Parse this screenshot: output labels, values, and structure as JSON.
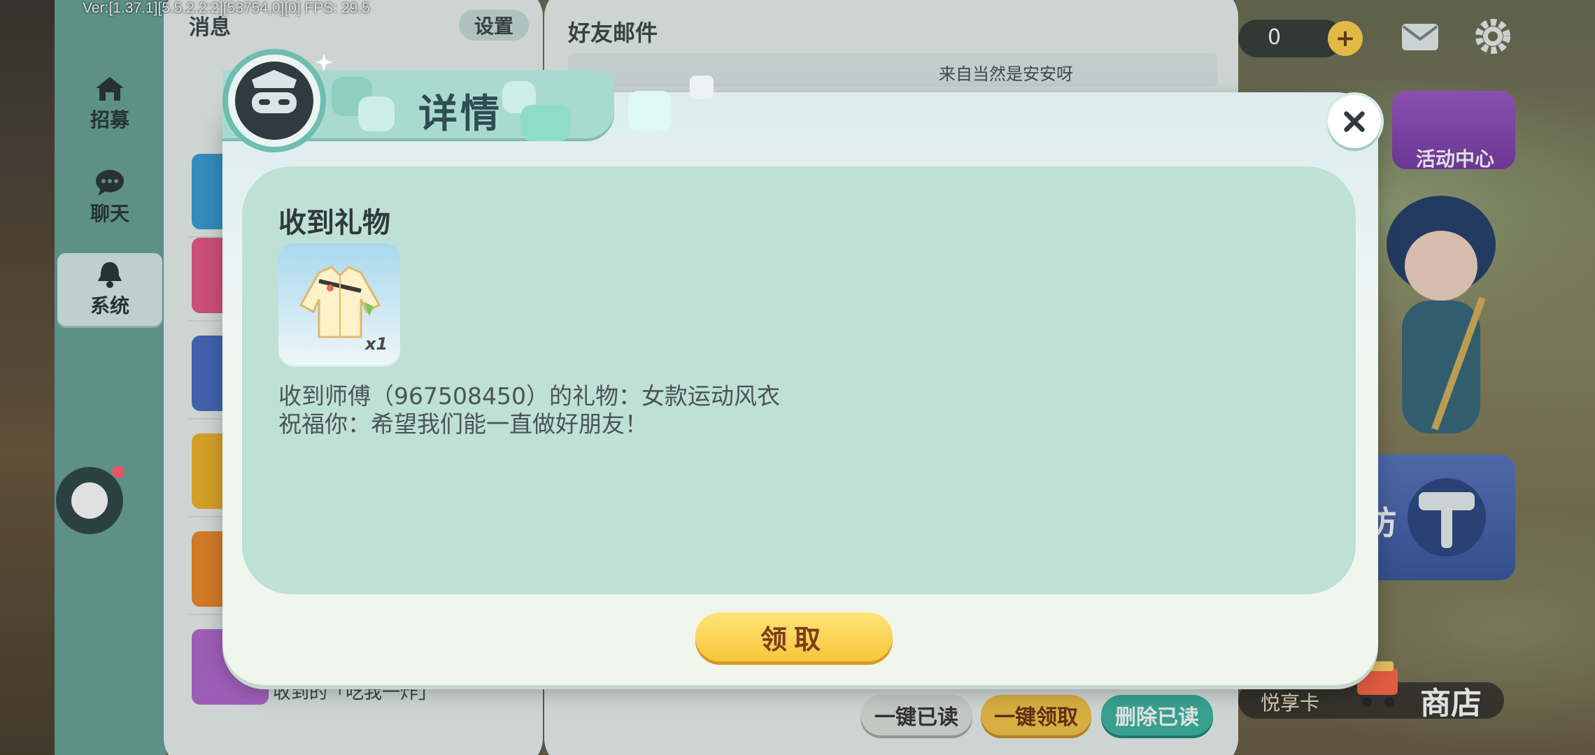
{
  "debug": {
    "text": "Ver:[1.37.1][5.5.2.2:2][53754,0][0] FPS: 29.5"
  },
  "sidebar": {
    "items": [
      {
        "label": "招募",
        "icon": "house-icon"
      },
      {
        "label": "聊天",
        "icon": "chat-bubble-icon"
      },
      {
        "label": "系统",
        "icon": "bell-icon",
        "active": true
      }
    ]
  },
  "message_panel": {
    "title": "消息",
    "settings_label": "设置",
    "last_item_text": "收到的「吃我一炸」"
  },
  "friend_panel": {
    "title": "好友邮件",
    "from_text": "来自当然是安安呀",
    "buttons": {
      "read_all": "一键已读",
      "claim_all": "一键领取",
      "delete_read": "删除已读"
    }
  },
  "hud": {
    "currency_value": "0",
    "activity_center": "活动中心",
    "build_label": "坊",
    "vip_card": "悦享卡",
    "shop": "商店"
  },
  "dialog": {
    "title": "详情",
    "section_title": "收到礼物",
    "item_count": "x1",
    "message_line1": "收到师傅（967508450）的礼物：女款运动风衣",
    "message_line2": "祝福你：希望我们能一直做好朋友！",
    "claim_label": "领取"
  },
  "colors": {
    "accent_teal": "#6ebdb0",
    "claim_yellow": "#f7c63a",
    "delete_green": "#3fb7a3"
  }
}
